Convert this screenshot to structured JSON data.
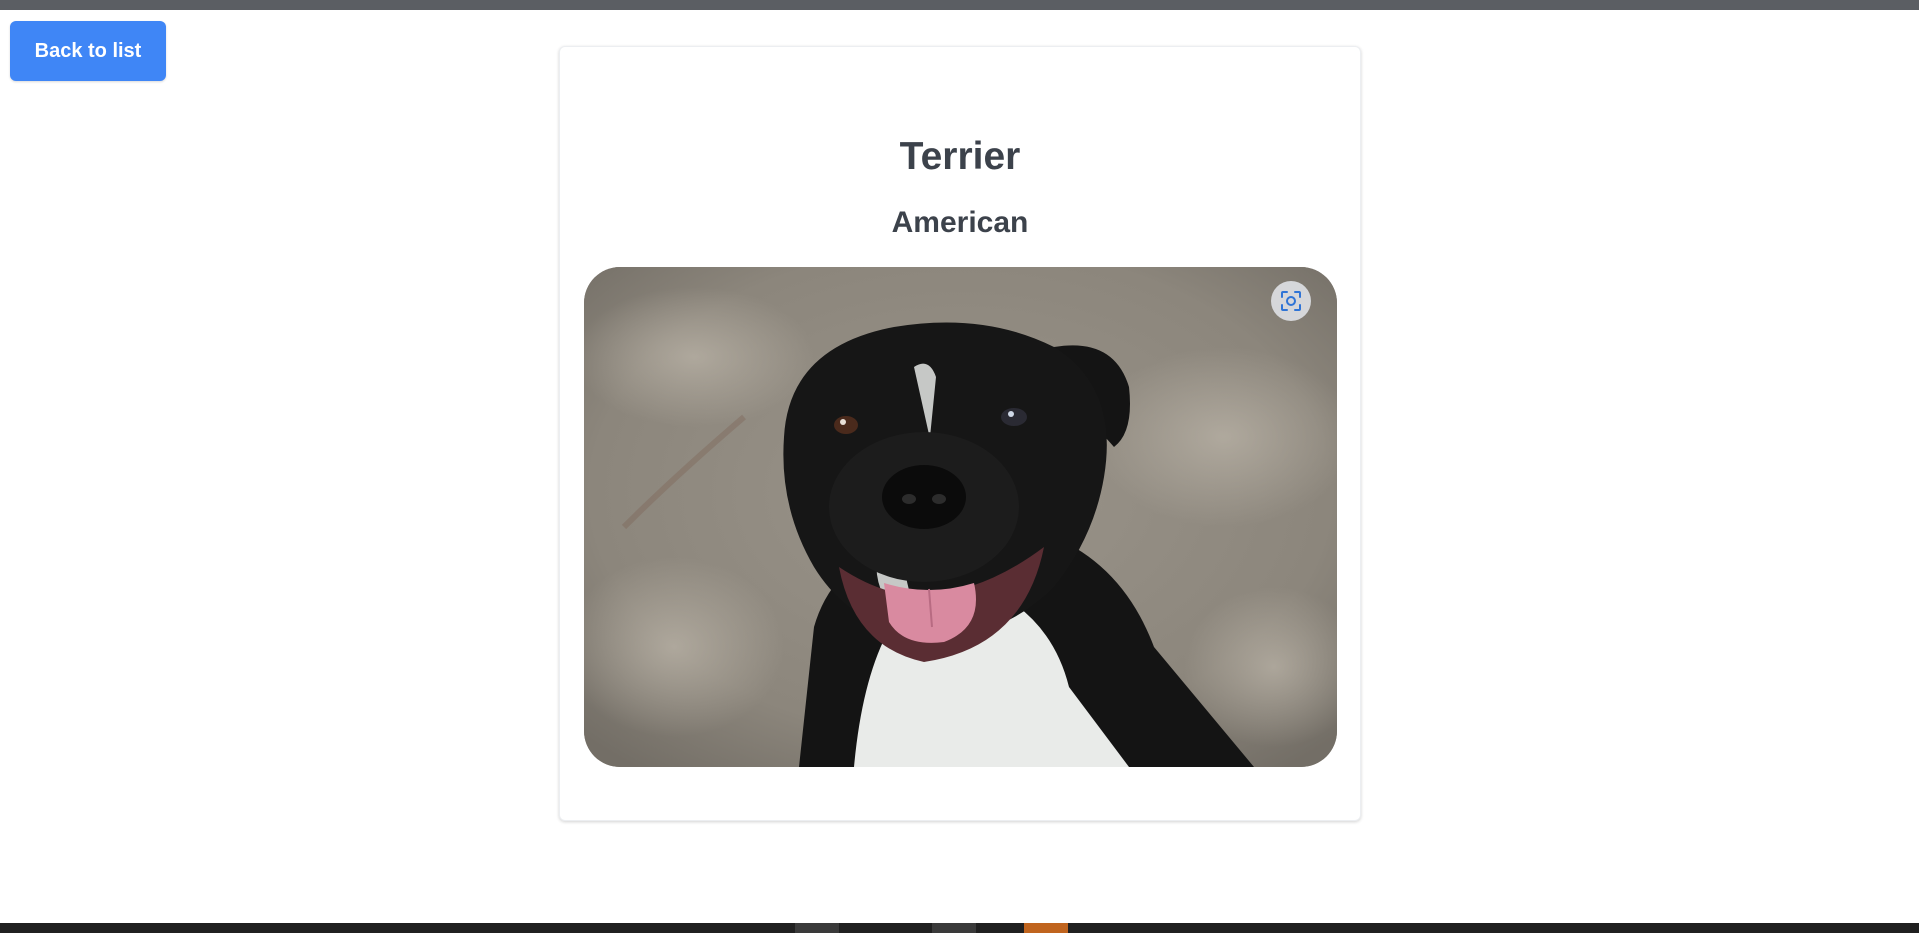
{
  "nav": {
    "back_label": "Back to list"
  },
  "breed": {
    "name": "Terrier",
    "sub_breed": "American"
  },
  "image": {
    "lens_icon": "visual-search-icon"
  },
  "colors": {
    "accent": "#3f86f6",
    "title_text": "#3c424b",
    "lens_icon": "#2f74d6"
  }
}
